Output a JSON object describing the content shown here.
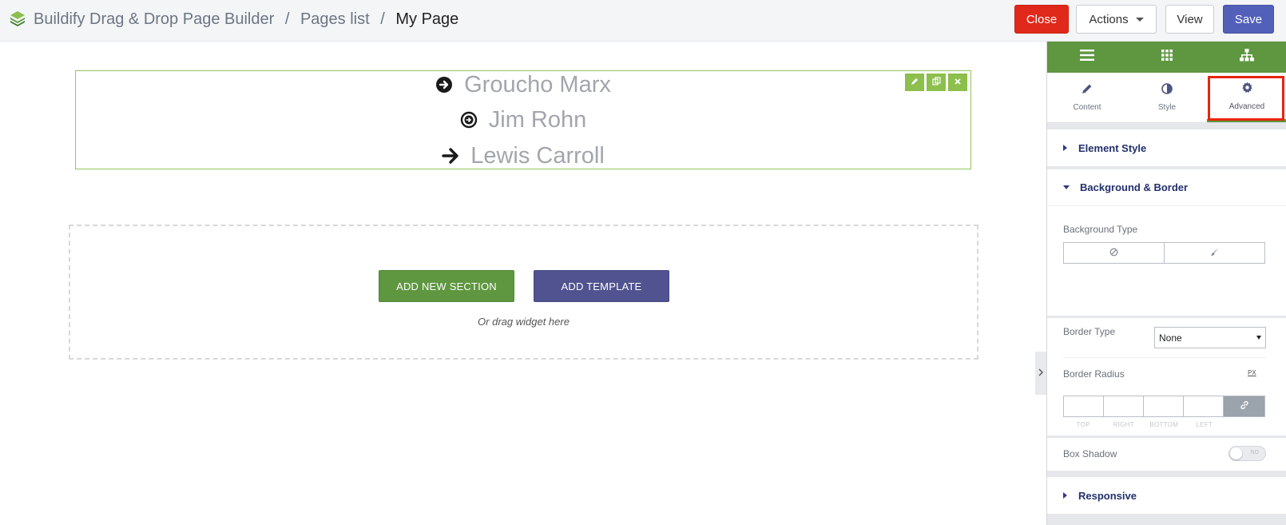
{
  "header": {
    "app_name": "Buildify Drag & Drop Page Builder",
    "separator": "/",
    "pages_list": "Pages list",
    "current_page": "My Page",
    "buttons": {
      "close": "Close",
      "actions": "Actions",
      "view": "View",
      "save": "Save"
    }
  },
  "canvas": {
    "quotes": [
      {
        "author": "Groucho Marx",
        "icon": "arrow-circle-right-icon"
      },
      {
        "author": "Jim Rohn",
        "icon": "arrow-circle-o-right-icon"
      },
      {
        "author": "Lewis Carroll",
        "icon": "arrow-right-icon"
      }
    ],
    "add_section": "ADD NEW SECTION",
    "add_template": "ADD TEMPLATE",
    "drag_hint": "Or drag widget here"
  },
  "panel": {
    "tabs": [
      {
        "label": "Content",
        "icon": "pencil-icon"
      },
      {
        "label": "Style",
        "icon": "contrast-icon"
      },
      {
        "label": "Advanced",
        "icon": "gear-icon",
        "active": true
      }
    ],
    "sections": {
      "element_style": "Element Style",
      "background_border": "Background & Border",
      "responsive": "Responsive"
    },
    "background_type_label": "Background Type",
    "border_type_label": "Border Type",
    "border_type_value": "None",
    "border_radius_label": "Border Radius",
    "border_radius_unit": "PX",
    "radius_labels": [
      "TOP",
      "RIGHT",
      "BOTTOM",
      "LEFT"
    ],
    "box_shadow_label": "Box Shadow",
    "box_shadow_value": "NO"
  },
  "colors": {
    "brand_green": "#5e9740",
    "close_red": "#e0291b",
    "save_blue": "#5260b9",
    "template_purple": "#50538f",
    "highlight_red": "#e8250c"
  }
}
